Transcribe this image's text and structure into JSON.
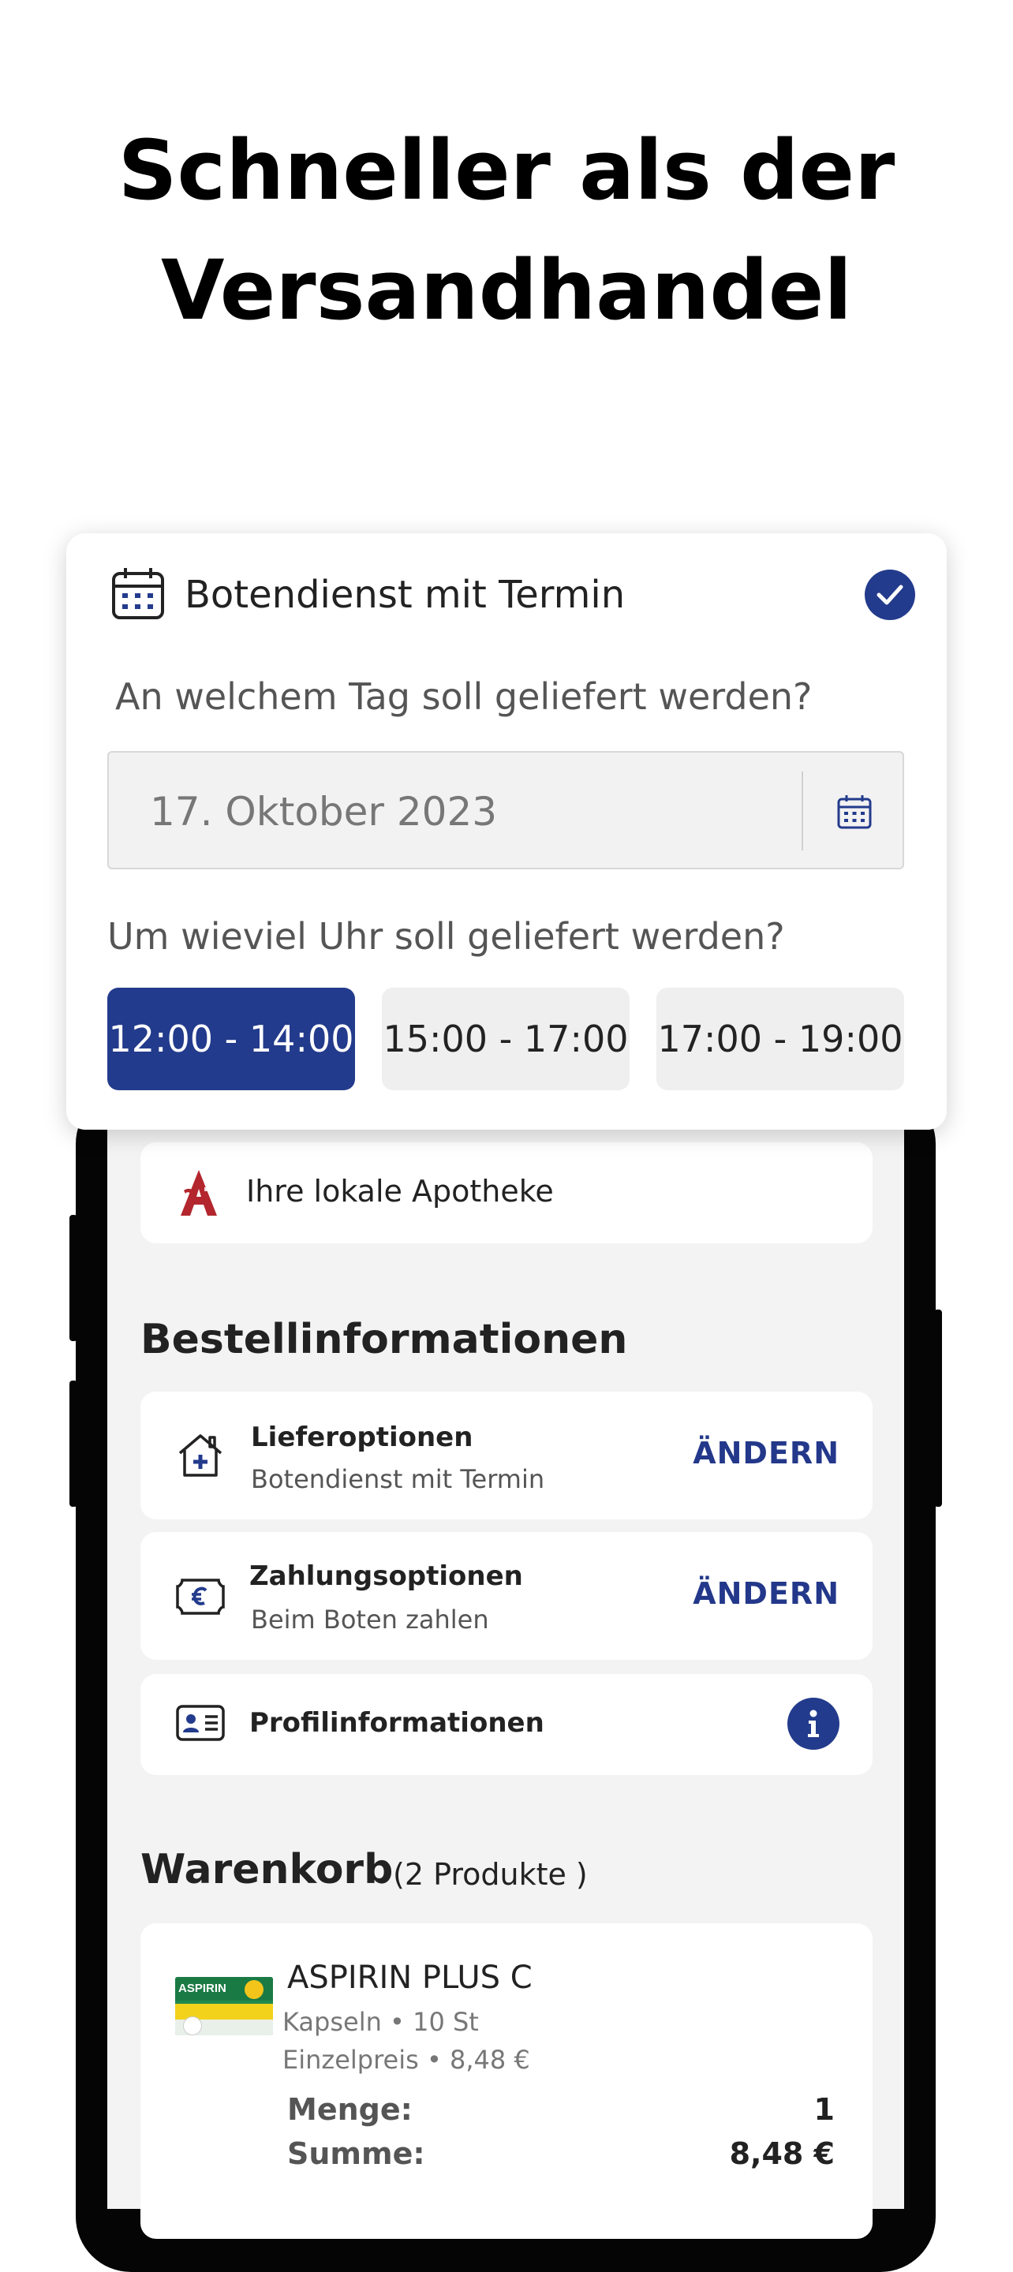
{
  "headline": {
    "line1": "Schneller als der",
    "line2": "Versandhandel"
  },
  "delivery_popup": {
    "title": "Botendienst mit Termin",
    "icon": "calendar-icon",
    "selected": true,
    "date_question": "An welchem Tag soll geliefert werden?",
    "date_value": "17. Oktober 2023",
    "time_question": "Um wieviel Uhr soll geliefert werden?",
    "time_slots": [
      {
        "label": "12:00 - 14:00",
        "selected": true
      },
      {
        "label": "15:00 - 17:00",
        "selected": false
      },
      {
        "label": "17:00 - 19:00",
        "selected": false
      }
    ]
  },
  "pharmacy": {
    "label": "Ihre lokale Apotheke",
    "icon": "apotheke-logo"
  },
  "order_info": {
    "heading": "Bestellinformationen",
    "delivery": {
      "title": "Lieferoptionen",
      "subtitle": "Botendienst mit Termin",
      "action": "ÄNDERN",
      "icon": "house-plus-icon"
    },
    "payment": {
      "title": "Zahlungsoptionen",
      "subtitle": "Beim Boten zahlen",
      "action": "ÄNDERN",
      "icon": "euro-bill-icon"
    },
    "profile": {
      "title": "Profilinformationen",
      "icon": "id-card-icon",
      "info_icon": "info-icon"
    }
  },
  "cart": {
    "heading": "Warenkorb",
    "count_text": "(2 Produkte )",
    "items": [
      {
        "name": "ASPIRIN PLUS C",
        "form": "Kapseln • 10 St",
        "unit_price": "Einzelpreis • 8,48 €",
        "quantity_label": "Menge:",
        "quantity": "1",
        "sum_label": "Summe:",
        "sum": "8,48 €"
      }
    ]
  },
  "colors": {
    "accent": "#233b8c",
    "pharmacy_red": "#b3262d",
    "screen_bg": "#f3f3f3"
  }
}
